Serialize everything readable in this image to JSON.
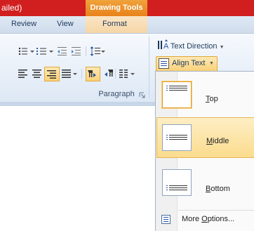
{
  "title_bar": {
    "doc_title_fragment": "ailed)"
  },
  "contextual_tab_group": {
    "title": "Drawing Tools"
  },
  "tabs": [
    {
      "label": "Review"
    },
    {
      "label": "View"
    },
    {
      "label": "Format"
    }
  ],
  "ribbon": {
    "paragraph_group_label": "Paragraph",
    "text_direction_label": "Text Direction",
    "align_text_label": "Align Text"
  },
  "align_text_menu": {
    "items": [
      {
        "label": "Top",
        "mnemonic": "T",
        "rest": "op",
        "state": "selected"
      },
      {
        "label": "Middle",
        "mnemonic": "M",
        "rest": "iddle",
        "state": "hover"
      },
      {
        "label": "Bottom",
        "mnemonic": "B",
        "rest": "ottom",
        "state": "normal"
      }
    ],
    "more_options": {
      "label": "More Options...",
      "prefix": "More ",
      "mnemonic": "O",
      "rest": "ptions..."
    }
  },
  "colors": {
    "title_bar": "#d11f1f",
    "contextual_tab": "#e8821a",
    "hover": "#fbdc8e",
    "ribbon": "#dde8f5"
  }
}
